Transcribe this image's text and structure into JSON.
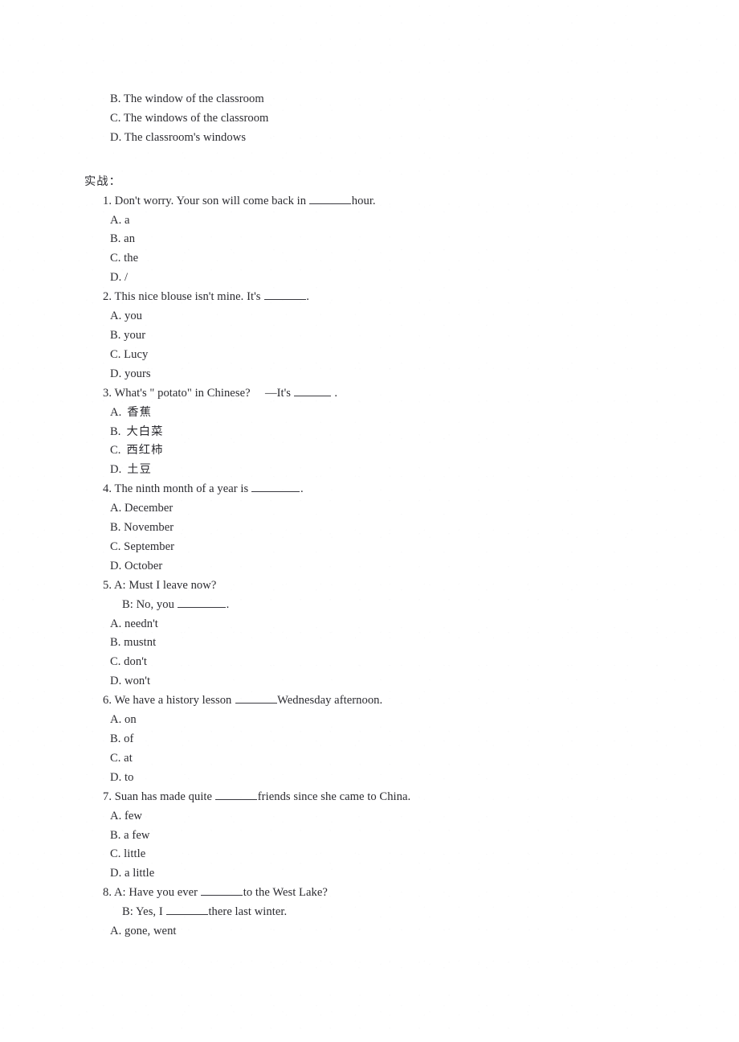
{
  "document": {
    "type": "english-exam-worksheet-scan",
    "background_color": "#ffffff",
    "text_color": "#2b2b30",
    "section_heading": "实战：",
    "carryover_options": [
      "B. The window of the classroom",
      "C. The windows of the classroom",
      "D. The classroom's windows"
    ],
    "questions": [
      {
        "number": "1.",
        "stem_before": "1. Don't worry. Your son will come back in ",
        "blank": "md",
        "stem_after": "hour.",
        "options": [
          "A. a",
          "B. an",
          "C. the",
          "D. /"
        ],
        "cjk_options": false
      },
      {
        "number": "2.",
        "stem_before": "2. This nice blouse isn't mine. It's ",
        "blank": "md",
        "stem_after": ".",
        "options": [
          "A. you",
          "B. your",
          "C. Lucy",
          "D. yours"
        ],
        "cjk_options": false
      },
      {
        "number": "3.",
        "stem_before": "3. What's \" potato\" in Chinese?　 —It's ",
        "blank": "sm",
        "stem_after": " .",
        "options": [
          "A.",
          "B.",
          "C.",
          "D."
        ],
        "option_texts": [
          "香蕉",
          "大白菜",
          "西红柿",
          "土豆"
        ],
        "cjk_options": true
      },
      {
        "number": "4.",
        "stem_before": "4. The ninth month of a year is ",
        "blank": "lg",
        "stem_after": ".",
        "options": [
          "A. December",
          "B. November",
          "C. September",
          "D. October"
        ],
        "cjk_options": false
      },
      {
        "number": "5.",
        "stem_before": "5. A: Must I leave now?",
        "blank": null,
        "stem_after": "",
        "sub_line_before": "B: No, you ",
        "sub_blank": "lg",
        "sub_line_after": ".",
        "options": [
          "A. needn't",
          "B. mustnt",
          "C. don't",
          "D. won't"
        ],
        "cjk_options": false
      },
      {
        "number": "6.",
        "stem_before": "6. We have a history lesson ",
        "blank": "md",
        "stem_after": "Wednesday afternoon.",
        "options": [
          "A. on",
          "B. of",
          "C. at",
          "D. to"
        ],
        "cjk_options": false
      },
      {
        "number": "7.",
        "stem_before": "7. Suan has made quite ",
        "blank": "md",
        "stem_after": "friends since she came to China.",
        "options": [
          "A. few",
          "B. a few",
          "C. little",
          "D. a little"
        ],
        "cjk_options": false
      },
      {
        "number": "8.",
        "stem_before": "8. A: Have you ever ",
        "blank": "md",
        "stem_after": "to the West Lake?",
        "sub_line_before": "B: Yes, I ",
        "sub_blank": "md",
        "sub_line_after": "there last winter.",
        "options": [
          "A. gone, went"
        ],
        "cjk_options": false
      }
    ]
  }
}
